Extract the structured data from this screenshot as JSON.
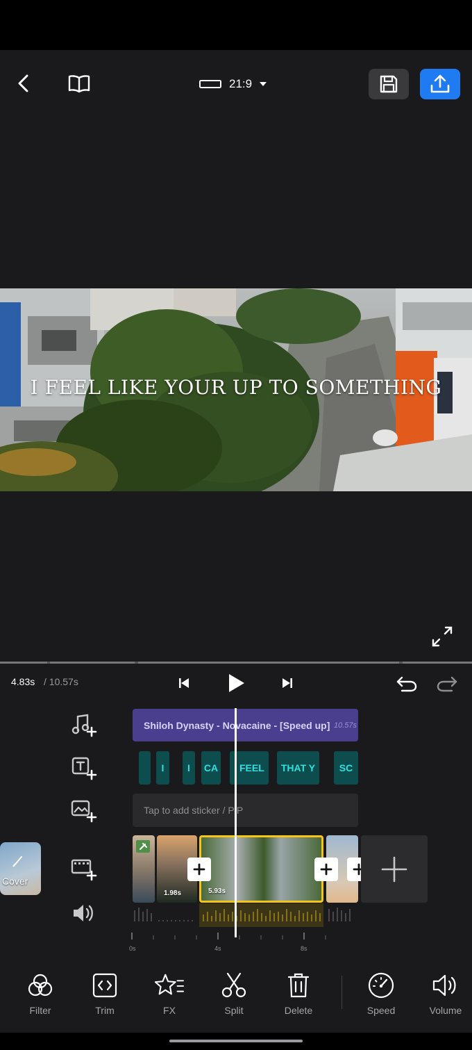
{
  "topbar": {
    "aspect_ratio": "21:9",
    "icons": {
      "back": "back-icon",
      "guide": "book-icon",
      "ratio": "ratio-rect-icon",
      "save": "save-icon",
      "export": "export-icon"
    },
    "accent": "#1e7bf2"
  },
  "preview": {
    "caption": "I FEEL LIKE YOUR UP TO SOMETHING"
  },
  "playback": {
    "current_time": "4.83s",
    "total_time": "/ 10.57s",
    "progress_fraction": 0.457
  },
  "timeline": {
    "music": {
      "title": "Shiloh Dynasty - Novacaine - [Speed up]",
      "duration": "10.57s",
      "color": "#4a3f8f"
    },
    "text_chips": [
      "",
      "I",
      "I",
      "CA",
      "I FEEL",
      "THAT Y",
      "SC"
    ],
    "sticker_placeholder": "Tap to add sticker / PiP",
    "cover_label": "Cover",
    "clips": [
      {
        "duration": ""
      },
      {
        "duration": "1.98s"
      },
      {
        "duration": "5.93s"
      },
      {
        "duration": ""
      }
    ],
    "ruler": [
      "0s",
      "4s",
      "8s"
    ],
    "selected_color": "#f5c518"
  },
  "toolbar": {
    "items": [
      {
        "label": "Filter",
        "icon": "filter-icon"
      },
      {
        "label": "Trim",
        "icon": "trim-icon"
      },
      {
        "label": "FX",
        "icon": "fx-star-icon"
      },
      {
        "label": "Split",
        "icon": "scissors-icon"
      },
      {
        "label": "Delete",
        "icon": "trash-icon"
      },
      {
        "label": "Speed",
        "icon": "speedometer-icon"
      },
      {
        "label": "Volume",
        "icon": "volume-icon"
      }
    ]
  }
}
